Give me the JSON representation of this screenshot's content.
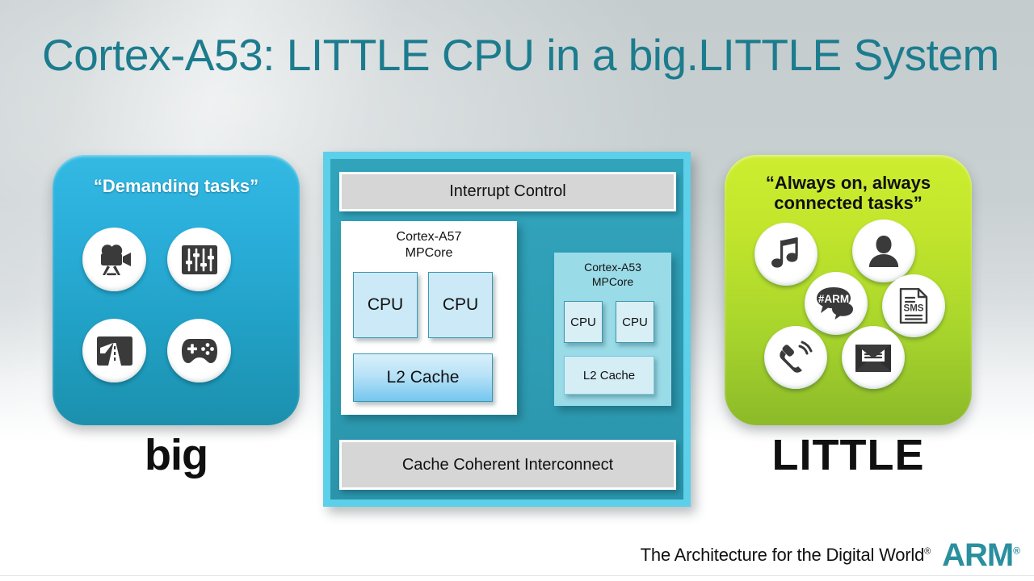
{
  "slide": {
    "title": "Cortex-A53: LITTLE CPU in a big.LITTLE System",
    "title_color": "#1c7c8e"
  },
  "big_panel": {
    "caption": "“Demanding tasks”",
    "label": "big",
    "accent_top": "#33b9e2",
    "accent_bottom": "#1b90ad",
    "icons": [
      {
        "name": "video-camera-icon"
      },
      {
        "name": "audio-equalizer-icon"
      },
      {
        "name": "navigation-map-icon"
      },
      {
        "name": "game-controller-icon"
      }
    ]
  },
  "little_panel": {
    "caption_line1": "“Always on, always",
    "caption_line2": "connected tasks”",
    "label": "LITTLE",
    "accent_top": "#cdee2f",
    "accent_bottom": "#8cba29",
    "icons": [
      {
        "name": "music-note-icon"
      },
      {
        "name": "contact-person-icon"
      },
      {
        "name": "social-chat-icon",
        "text": "#ARM"
      },
      {
        "name": "sms-document-icon",
        "text": "SMS"
      },
      {
        "name": "phone-ringing-icon"
      },
      {
        "name": "envelope-mail-icon"
      }
    ]
  },
  "soc": {
    "interrupt_control": "Interrupt Control",
    "cache_coherent_interconnect": "Cache Coherent Interconnect",
    "frame_color": "#5ccfe9",
    "body_color": "#2e9db4",
    "bar_color": "#d6d6d6",
    "a57": {
      "title_line1": "Cortex-A57",
      "title_line2": "MPCore",
      "cpus": [
        "CPU",
        "CPU"
      ],
      "l2": "L2 Cache",
      "background": "#ffffff"
    },
    "a53": {
      "title_line1": "Cortex-A53",
      "title_line2": "MPCore",
      "cpus": [
        "CPU",
        "CPU"
      ],
      "l2": "L2 Cache",
      "background": "#9adbe8"
    }
  },
  "footer": {
    "tagline": "The Architecture for the Digital World",
    "tagline_mark": "®",
    "logo": "ARM",
    "logo_mark": "®",
    "logo_color": "#2a8f9e"
  }
}
